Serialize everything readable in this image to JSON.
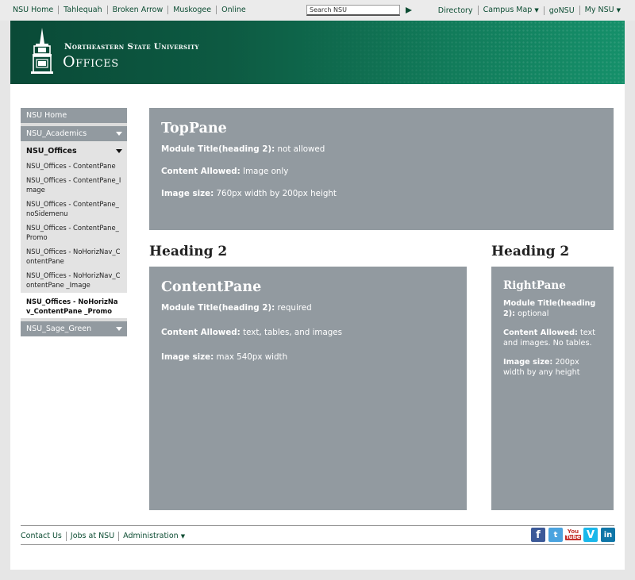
{
  "topbar": {
    "left_links": [
      "NSU Home",
      "Tahlequah",
      "Broken Arrow",
      "Muskogee",
      "Online"
    ],
    "search_placeholder": "Search NSU",
    "right_links": {
      "directory": "Directory",
      "campus_map": "Campus Map",
      "gonsu": "goNSU",
      "my_nsu": "My NSU"
    }
  },
  "banner": {
    "university": "Northeastern State University",
    "site": "Offices"
  },
  "sidemenu": {
    "nsu_home": "NSU Home",
    "academics": "NSU_Academics",
    "offices": "NSU_Offices",
    "offices_children": [
      "NSU_Offices - ContentPane",
      "NSU_Offices - ContentPane_Image",
      "NSU_Offices - ContentPane_noSidemenu",
      "NSU_Offices - ContentPane_Promo",
      "NSU_Offices - NoHorizNav_ContentPane",
      "NSU_Offices - NoHorizNav_ContentPane _Image"
    ],
    "active_item": "NSU_Offices - NoHorizNav_ContentPane _Promo",
    "sage_green": "NSU_Sage_Green"
  },
  "top_pane": {
    "title": "TopPane",
    "module_title_label": "Module Title(heading 2):",
    "module_title_value": " not allowed",
    "content_label": "Content Allowed:",
    "content_value": " Image only",
    "image_label": "Image size:",
    "image_value": " 760px width by 200px height"
  },
  "content_heading": "Heading 2",
  "content_pane": {
    "title": "ContentPane",
    "module_title_label": "Module Title(heading 2):",
    "module_title_value": " required",
    "content_label": "Content Allowed:",
    "content_value": " text, tables, and images",
    "image_label": "Image size:",
    "image_value": " max 540px width"
  },
  "right_heading": "Heading 2",
  "right_pane": {
    "title": "RightPane",
    "module_title_label": "Module Title(heading 2):",
    "module_title_value": " optional",
    "content_label": "Content Allowed:",
    "content_value": " text and images. No tables.",
    "image_label": "Image size:",
    "image_value": " 200px width by any height"
  },
  "footer": {
    "contact": "Contact Us",
    "jobs": "Jobs at NSU",
    "administration": "Administration"
  },
  "social_icons": [
    "facebook-icon",
    "twitter-icon",
    "youtube-icon",
    "vimeo-icon",
    "linkedin-icon"
  ],
  "colors": {
    "brand_green": "#0d5a42",
    "pane_gray": "#929aa0",
    "link_green": "#0d4d33"
  }
}
